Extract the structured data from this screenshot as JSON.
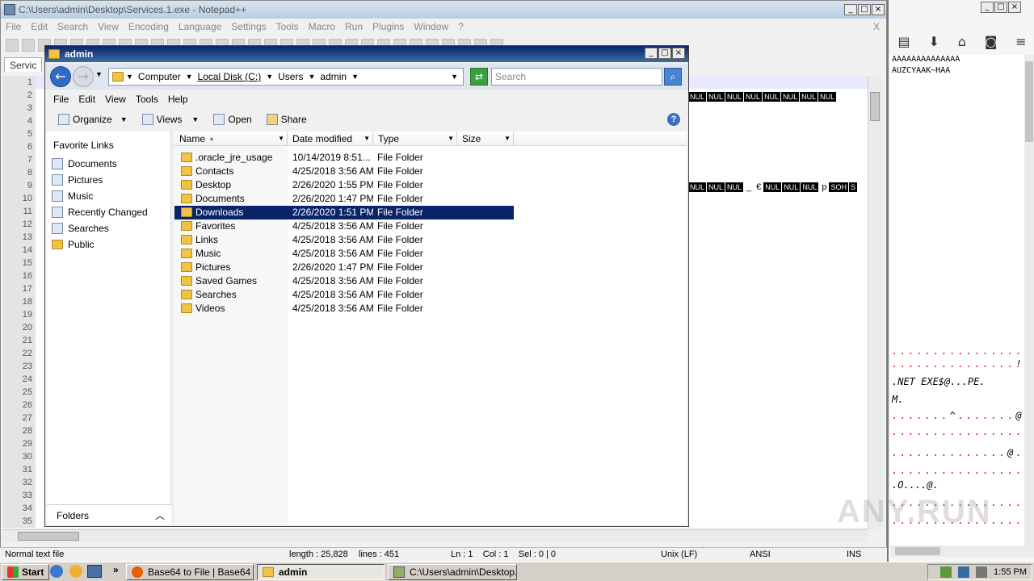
{
  "notepad": {
    "title": "C:\\Users\\admin\\Desktop\\Services.1.exe - Notepad++",
    "menu": [
      "File",
      "Edit",
      "Search",
      "View",
      "Encoding",
      "Language",
      "Settings",
      "Tools",
      "Macro",
      "Run",
      "Plugins",
      "Window",
      "?"
    ],
    "close_x": "X",
    "tab_label": "Servic",
    "line_numbers": [
      "1",
      "2",
      "3",
      "4",
      "5",
      "6",
      "7",
      "8",
      "9",
      "10",
      "11",
      "12",
      "13",
      "14",
      "15",
      "16",
      "17",
      "18",
      "19",
      "20",
      "21",
      "22",
      "23",
      "24",
      "25",
      "26",
      "27",
      "28",
      "29",
      "30",
      "31",
      "32",
      "33",
      "34",
      "35"
    ],
    "line2_tokens": [
      "NUL",
      "NUL",
      "NUL",
      "NUL",
      "NUL",
      "NUL",
      "NUL",
      "NUL"
    ],
    "line9_tokens": [
      "NUL",
      "NUL",
      "NUL",
      "_",
      "€",
      "NUL",
      "NUL",
      "NUL",
      "p",
      "SOH",
      "S"
    ],
    "status": {
      "file_type": "Normal text file",
      "length": "length : 25,828",
      "lines": "lines : 451",
      "position": "Ln : 1    Col : 1    Sel : 0 | 0",
      "eol": "Unix (LF)",
      "encoding": "ANSI",
      "mode": "INS"
    }
  },
  "browser": {
    "icons": [
      "clipboard-icon",
      "download-icon",
      "home-icon",
      "pocket-icon",
      "menu-icon"
    ],
    "snippet_top": "AAAAAAAAAAAAAA",
    "snippet_2": "AUZCYAAK~HAA",
    "text_net": ".NET EXE$@...PE.",
    "text_m": "M.",
    "text_caret": "^",
    "text_at1": "@",
    "text_at2": "@",
    "text_o": ".O....@.",
    "text_excl": "!",
    "watermark": "ANY.RUN"
  },
  "explorer": {
    "title": "admin",
    "address": {
      "computer": "Computer",
      "drive": "Local Disk (C:)",
      "users": "Users",
      "admin": "admin"
    },
    "search_placeholder": "Search",
    "menu": [
      "File",
      "Edit",
      "View",
      "Tools",
      "Help"
    ],
    "commands": {
      "organize": "Organize",
      "views": "Views",
      "open": "Open",
      "share": "Share"
    },
    "help_icon": "?",
    "nav": {
      "header": "Favorite Links",
      "items": [
        "Documents",
        "Pictures",
        "Music",
        "Recently Changed",
        "Searches",
        "Public"
      ],
      "folders_label": "Folders"
    },
    "columns": [
      "Name",
      "Date modified",
      "Type",
      "Size"
    ],
    "files": [
      {
        "name": ".oracle_jre_usage",
        "date": "10/14/2019 8:51...",
        "type": "File Folder"
      },
      {
        "name": "Contacts",
        "date": "4/25/2018 3:56 AM",
        "type": "File Folder"
      },
      {
        "name": "Desktop",
        "date": "2/26/2020 1:55 PM",
        "type": "File Folder"
      },
      {
        "name": "Documents",
        "date": "2/26/2020 1:47 PM",
        "type": "File Folder"
      },
      {
        "name": "Downloads",
        "date": "2/26/2020 1:51 PM",
        "type": "File Folder"
      },
      {
        "name": "Favorites",
        "date": "4/25/2018 3:56 AM",
        "type": "File Folder"
      },
      {
        "name": "Links",
        "date": "4/25/2018 3:56 AM",
        "type": "File Folder"
      },
      {
        "name": "Music",
        "date": "4/25/2018 3:56 AM",
        "type": "File Folder"
      },
      {
        "name": "Pictures",
        "date": "2/26/2020 1:47 PM",
        "type": "File Folder"
      },
      {
        "name": "Saved Games",
        "date": "4/25/2018 3:56 AM",
        "type": "File Folder"
      },
      {
        "name": "Searches",
        "date": "4/25/2018 3:56 AM",
        "type": "File Folder"
      },
      {
        "name": "Videos",
        "date": "4/25/2018 3:56 AM",
        "type": "File Folder"
      }
    ],
    "selected_index": 4
  },
  "taskbar": {
    "start": "Start",
    "overflow": "»",
    "tasks": [
      {
        "label": "Base64 to File | Base64 ..."
      },
      {
        "label": "admin"
      },
      {
        "label": "C:\\Users\\admin\\Desktop..."
      }
    ],
    "clock": "1:55 PM"
  },
  "colors": {
    "selection": "#0a246a",
    "explorer_title": "#0a246a",
    "dots": "#dd0000"
  }
}
